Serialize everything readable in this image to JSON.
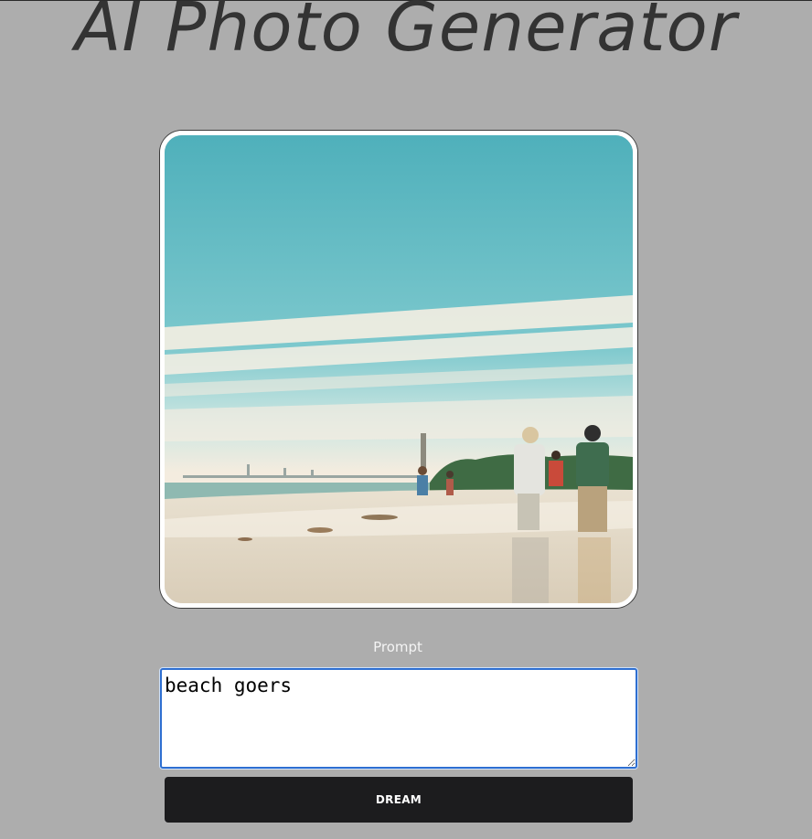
{
  "header": {
    "title": "AI Photo Generator"
  },
  "generated_image": {
    "subject": "beach-scene"
  },
  "form": {
    "prompt_label": "Prompt",
    "prompt_value": "beach goers",
    "submit_label": "DREAM"
  },
  "colors": {
    "page_background": "#adadad",
    "title_text": "#333333",
    "button_background": "#1c1c1e",
    "button_text": "#ffffff",
    "input_focus_border": "#2e6fd1",
    "image_border": "#ffffff"
  }
}
